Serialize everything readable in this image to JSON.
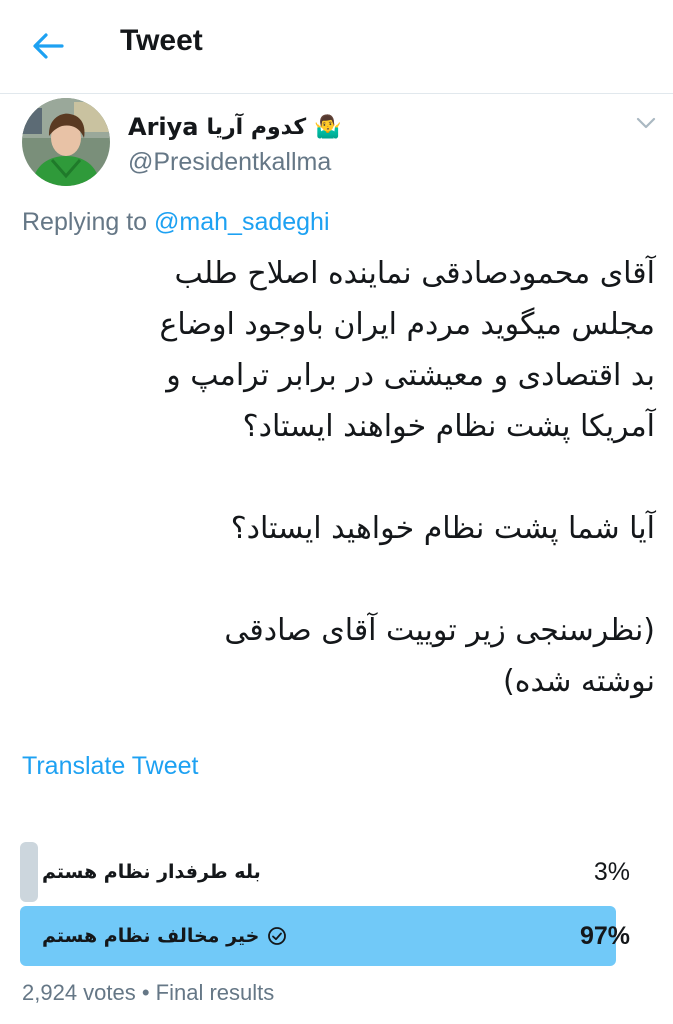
{
  "header": {
    "title": "Tweet"
  },
  "author": {
    "display_name": "Ariya",
    "display_name_fa": "کدوم آریا",
    "emoji": "🤷‍♂️",
    "handle": "@Presidentkallma"
  },
  "reply": {
    "prefix": "Replying to",
    "mention": "@mah_sadeghi"
  },
  "tweet": {
    "paragraph1_lines": [
      "آقای محمودصادقی نماینده اصلاح طلب",
      "مجلس میگوید مردم ایران باوجود اوضاع",
      "بد اقتصادی و معیشتی در برابر ترامپ و",
      "آمریکا پشت نظام خواهند ایستاد؟"
    ],
    "paragraph2": "آیا شما پشت نظام خواهید ایستاد؟",
    "paragraph3_lines": [
      "(نظرسنجی زیر توییت آقای صادقی",
      "نوشته شده)"
    ]
  },
  "translate_label": "Translate Tweet",
  "poll": {
    "options": [
      {
        "label": "بله طرفدار نظام هستم",
        "percent_label": "3%",
        "percent": 3,
        "winner": false
      },
      {
        "label": "خیر مخالف نظام هستم",
        "percent_label": "97%",
        "percent": 97,
        "winner": true
      }
    ],
    "footer": "2,924 votes • Final results"
  },
  "colors": {
    "accent": "#1da1f2",
    "winner_bar": "#71c9f8",
    "loser_bar": "#ccd6dd",
    "secondary_text": "#657786"
  },
  "icons": {
    "back": "arrow-left-icon",
    "caret": "chevron-down-icon",
    "winner_check": "check-circle-icon"
  }
}
